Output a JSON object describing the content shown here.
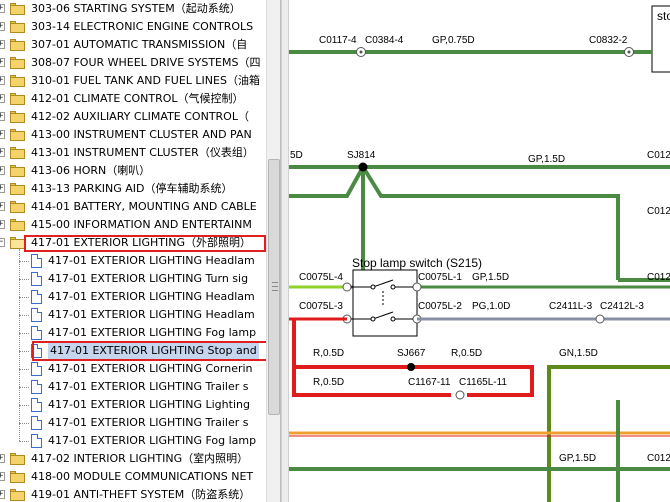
{
  "tree": {
    "items": [
      {
        "label": "303-06 STARTING SYSTEM（起动系统）",
        "type": "folder",
        "level": 0
      },
      {
        "label": "303-14 ELECTRONIC ENGINE CONTROLS",
        "type": "folder",
        "level": 0
      },
      {
        "label": "307-01 AUTOMATIC TRANSMISSION（自",
        "type": "folder",
        "level": 0
      },
      {
        "label": "308-07 FOUR WHEEL DRIVE SYSTEMS（四",
        "type": "folder",
        "level": 0
      },
      {
        "label": "310-01 FUEL TANK AND FUEL LINES（油箱",
        "type": "folder",
        "level": 0
      },
      {
        "label": "412-01 CLIMATE CONTROL（气候控制）",
        "type": "folder",
        "level": 0
      },
      {
        "label": "412-02 AUXILIARY CLIMATE CONTROL（",
        "type": "folder",
        "level": 0
      },
      {
        "label": "413-00 INSTRUMENT CLUSTER AND PAN",
        "type": "folder",
        "level": 0
      },
      {
        "label": "413-01 INSTRUMENT CLUSTER（仪表组）",
        "type": "folder",
        "level": 0
      },
      {
        "label": "413-06 HORN（喇叭）",
        "type": "folder",
        "level": 0
      },
      {
        "label": "413-13 PARKING AID（停车辅助系统）",
        "type": "folder",
        "level": 0
      },
      {
        "label": "414-01 BATTERY, MOUNTING AND CABLE",
        "type": "folder",
        "level": 0
      },
      {
        "label": "415-00 INFORMATION AND ENTERTAINM",
        "type": "folder",
        "level": 0
      },
      {
        "label": "417-01 EXTERIOR LIGHTING（外部照明）",
        "type": "folder",
        "level": 0,
        "open": true,
        "highlight": true
      },
      {
        "label": "417-01 EXTERIOR LIGHTING Headlam",
        "type": "doc",
        "level": 1
      },
      {
        "label": "417-01 EXTERIOR LIGHTING Turn sig",
        "type": "doc",
        "level": 1
      },
      {
        "label": "417-01 EXTERIOR LIGHTING Headlam",
        "type": "doc",
        "level": 1
      },
      {
        "label": "417-01 EXTERIOR LIGHTING Headlam",
        "type": "doc",
        "level": 1
      },
      {
        "label": "417-01 EXTERIOR LIGHTING Fog lamp",
        "type": "doc",
        "level": 1
      },
      {
        "label": "417-01 EXTERIOR LIGHTING Stop and",
        "type": "doc",
        "level": 1,
        "selected": true,
        "highlight": true
      },
      {
        "label": "417-01 EXTERIOR LIGHTING Cornerin",
        "type": "doc",
        "level": 1
      },
      {
        "label": "417-01 EXTERIOR LIGHTING Trailer s",
        "type": "doc",
        "level": 1
      },
      {
        "label": "417-01 EXTERIOR LIGHTING Lighting",
        "type": "doc",
        "level": 1
      },
      {
        "label": "417-01 EXTERIOR LIGHTING Trailer s",
        "type": "doc",
        "level": 1
      },
      {
        "label": "417-01 EXTERIOR LIGHTING Fog lamp",
        "type": "doc",
        "level": 1
      },
      {
        "label": "417-02 INTERIOR LIGHTING（室内照明）",
        "type": "folder",
        "level": 0
      },
      {
        "label": "418-00 MODULE COMMUNICATIONS NET",
        "type": "folder",
        "level": 0
      },
      {
        "label": "419-01 ANTI-THEFT SYSTEM（防盗系统）",
        "type": "folder",
        "level": 0
      }
    ]
  },
  "diagram": {
    "colors": {
      "green": "#4b8a43",
      "gray": "#8a8a8a",
      "red": "#e01b1b",
      "olive": "#5e8a1a",
      "ltgreen": "#8fd22a",
      "orange": "#f0a030",
      "slate": "#8790a4"
    },
    "top_label": "sto",
    "labels": {
      "c0117": "C0117-4",
      "c0384": "C0384-4",
      "gp075": "GP,0.75D",
      "c0832": "C0832-2",
      "left_5d": "5D",
      "sj814": "SJ814",
      "gp15_top": "GP,1.5D",
      "c012_a": "C012",
      "c012_b": "C012",
      "c012_c": "C012",
      "switch_title": "Stop lamp switch (S215)",
      "c0075l4": "C0075L-4",
      "c0075l1": "C0075L-1",
      "gp15_mid": "GP,1.5D",
      "c0075l3": "C0075L-3",
      "c0075l2": "C0075L-2",
      "pg10": "PG,1.0D",
      "c2411": "C2411L-3",
      "c2412": "C2412L-3",
      "r05_a": "R,0.5D",
      "sj667": "SJ667",
      "r05_b": "R,0.5D",
      "gn15": "GN,1.5D",
      "r05_c": "R,0.5D",
      "c1167": "C1167-11",
      "c1165": "C1165L-11",
      "gp15_bot": "GP,1.5D"
    }
  }
}
